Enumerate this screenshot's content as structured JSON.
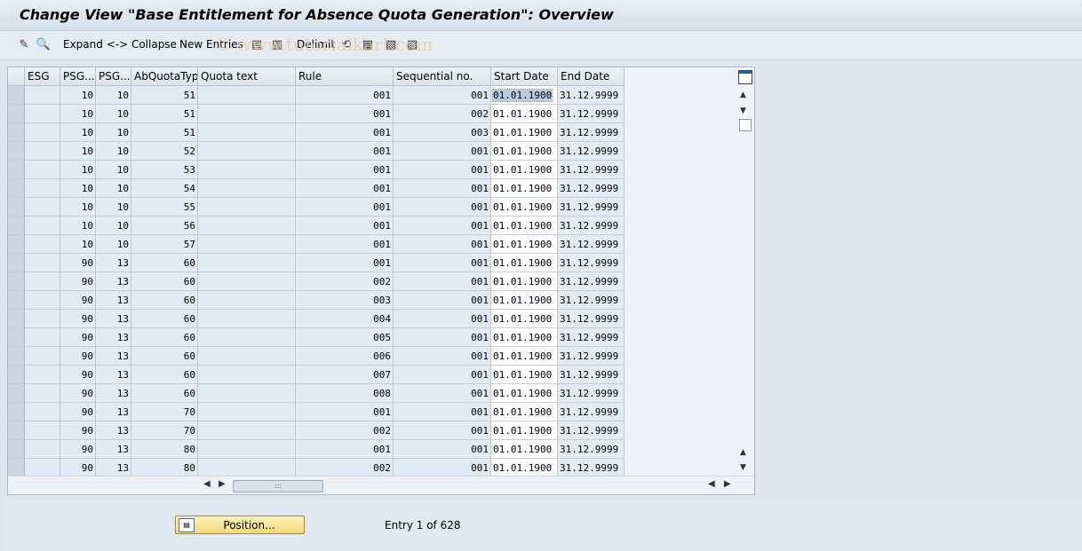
{
  "title": "Change View \"Base Entitlement for Absence Quota Generation\": Overview",
  "toolbar": {
    "expand_collapse": "Expand <-> Collapse",
    "new_entries": "New Entries",
    "delimit": "Delimit",
    "watermark": "© www.tutorialkart.com"
  },
  "table": {
    "headers": [
      "ESG",
      "PSG...",
      "PSG...",
      "AbQuotaTyp",
      "Quota text",
      "Rule",
      "Sequential no.",
      "Start Date",
      "End Date"
    ],
    "rows": [
      [
        "",
        "10",
        "10",
        "51",
        "",
        "001",
        "001",
        "01.01.1900",
        "31.12.9999"
      ],
      [
        "",
        "10",
        "10",
        "51",
        "",
        "001",
        "002",
        "01.01.1900",
        "31.12.9999"
      ],
      [
        "",
        "10",
        "10",
        "51",
        "",
        "001",
        "003",
        "01.01.1900",
        "31.12.9999"
      ],
      [
        "",
        "10",
        "10",
        "52",
        "",
        "001",
        "001",
        "01.01.1900",
        "31.12.9999"
      ],
      [
        "",
        "10",
        "10",
        "53",
        "",
        "001",
        "001",
        "01.01.1900",
        "31.12.9999"
      ],
      [
        "",
        "10",
        "10",
        "54",
        "",
        "001",
        "001",
        "01.01.1900",
        "31.12.9999"
      ],
      [
        "",
        "10",
        "10",
        "55",
        "",
        "001",
        "001",
        "01.01.1900",
        "31.12.9999"
      ],
      [
        "",
        "10",
        "10",
        "56",
        "",
        "001",
        "001",
        "01.01.1900",
        "31.12.9999"
      ],
      [
        "",
        "10",
        "10",
        "57",
        "",
        "001",
        "001",
        "01.01.1900",
        "31.12.9999"
      ],
      [
        "",
        "90",
        "13",
        "60",
        "",
        "001",
        "001",
        "01.01.1900",
        "31.12.9999"
      ],
      [
        "",
        "90",
        "13",
        "60",
        "",
        "002",
        "001",
        "01.01.1900",
        "31.12.9999"
      ],
      [
        "",
        "90",
        "13",
        "60",
        "",
        "003",
        "001",
        "01.01.1900",
        "31.12.9999"
      ],
      [
        "",
        "90",
        "13",
        "60",
        "",
        "004",
        "001",
        "01.01.1900",
        "31.12.9999"
      ],
      [
        "",
        "90",
        "13",
        "60",
        "",
        "005",
        "001",
        "01.01.1900",
        "31.12.9999"
      ],
      [
        "",
        "90",
        "13",
        "60",
        "",
        "006",
        "001",
        "01.01.1900",
        "31.12.9999"
      ],
      [
        "",
        "90",
        "13",
        "60",
        "",
        "007",
        "001",
        "01.01.1900",
        "31.12.9999"
      ],
      [
        "",
        "90",
        "13",
        "60",
        "",
        "008",
        "001",
        "01.01.1900",
        "31.12.9999"
      ],
      [
        "",
        "90",
        "13",
        "70",
        "",
        "001",
        "001",
        "01.01.1900",
        "31.12.9999"
      ],
      [
        "",
        "90",
        "13",
        "70",
        "",
        "002",
        "001",
        "01.01.1900",
        "31.12.9999"
      ],
      [
        "",
        "90",
        "13",
        "80",
        "",
        "001",
        "001",
        "01.01.1900",
        "31.12.9999"
      ],
      [
        "",
        "90",
        "13",
        "80",
        "",
        "002",
        "001",
        "01.01.1900",
        "31.12.9999"
      ]
    ]
  },
  "footer": {
    "position_button": "Position...",
    "entry_info": "Entry 1 of 628"
  }
}
